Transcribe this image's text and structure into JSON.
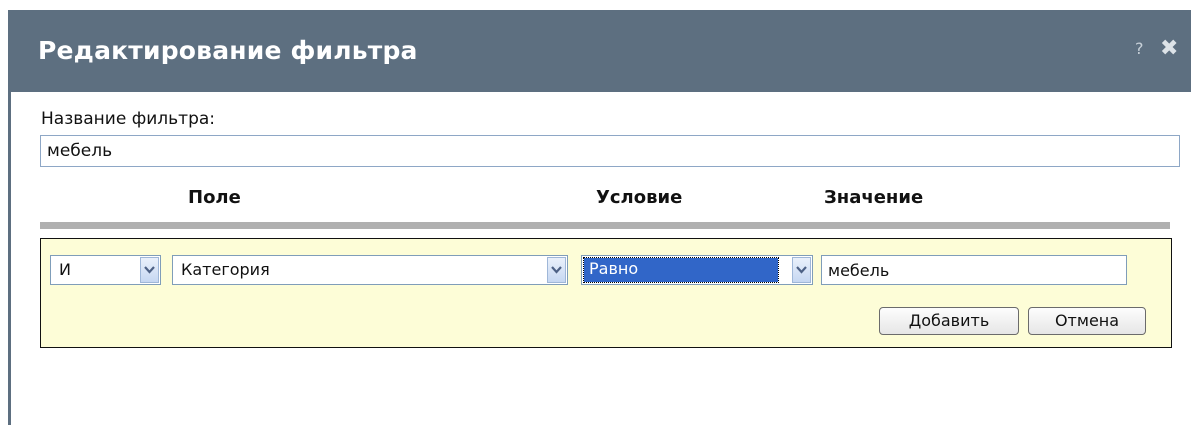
{
  "window": {
    "title": "Редактирование фильтра",
    "help_label": "?",
    "close_label": "✖"
  },
  "filter_name": {
    "label": "Название фильтра:",
    "value": "мебель"
  },
  "columns": {
    "field": "Поле",
    "condition": "Условие",
    "value": "Значение"
  },
  "rule": {
    "logic": "И",
    "field": "Категория",
    "condition": "Равно",
    "value": "мебель"
  },
  "buttons": {
    "add": "Добавить",
    "cancel": "Отмена"
  },
  "icons": {
    "help": "help-icon",
    "close": "close-icon",
    "dropdown": "chevron-down-icon"
  },
  "colors": {
    "titlebar": "#5d6f80",
    "rule_background": "#fdfdd7",
    "selection": "#3166c8"
  }
}
